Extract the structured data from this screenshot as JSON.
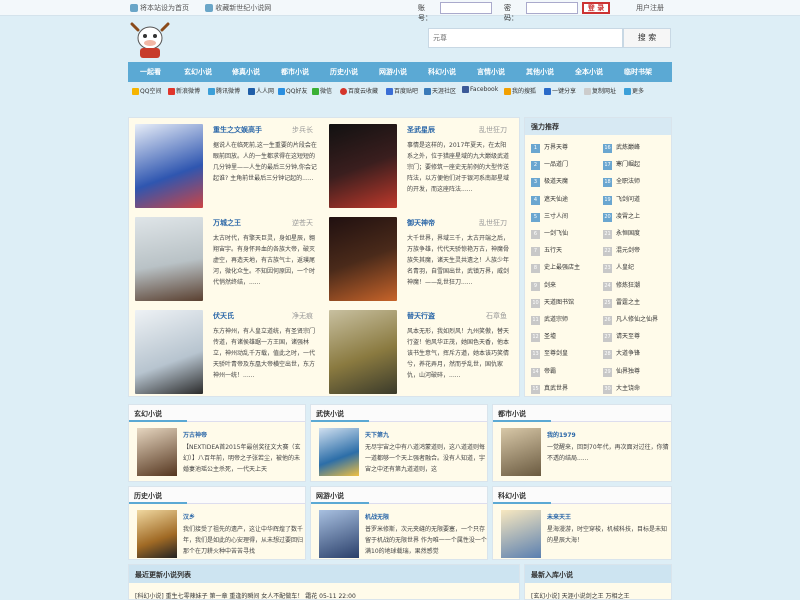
{
  "topbar": {
    "set_home": "将本站设为首页",
    "bookmark": "收藏新世纪小说网",
    "account_label": "账号：",
    "password_label": "密码：",
    "login": "登 录",
    "register": "用户注册"
  },
  "search": {
    "placeholder": "元尊",
    "button": "搜 索"
  },
  "nav": [
    "一起看",
    "玄幻小说",
    "修真小说",
    "都市小说",
    "历史小说",
    "网游小说",
    "科幻小说",
    "言情小说",
    "其他小说",
    "全本小说",
    "临时书架"
  ],
  "share": [
    "QQ空间",
    "新浪微博",
    "腾讯微博",
    "人人网",
    "QQ好友",
    "微信",
    "百度云收藏",
    "百度贴吧",
    "天涯社区",
    "Facebook",
    "我的搜狐",
    "一键分享",
    "复制网址",
    "更多"
  ],
  "featured": [
    {
      "title": "重生之文娱高手",
      "author": "步兵长",
      "desc": "据说人在临死前,这一生重要的片段会在眼前回放。人的一生都求得在这短短的几分钟里——人生的最后三分钟,你会记起谁? 主角前世最后三分钟记起的......",
      "cover_color": "#2f56b0"
    },
    {
      "title": "圣武星辰",
      "author": "乱世狂刀",
      "desc": "事情是这样的，2017年夏天，在太阳系之外，位于猎座星域的九大巅级武道宗门；要修筑一座史无前例的大型传送阵法，以方便他们对于银河系南部星域的开发，而这座阵法......",
      "cover_color": "#3a1e1e"
    },
    {
      "title": "万城之王",
      "author": "逆苍天",
      "desc": "太古时代，有擎天巨灵，身如星辰，翱翔宙宇。有身怀异血的各族大帝，破灭虚空，再造天地，有古族气士，返璞尾河，微化众生。不知因何原因，一个时代悄然终结，......",
      "cover_color": "#b9c2c6"
    },
    {
      "title": "御天神帝",
      "author": "乱世狂刀",
      "desc": "大千世界，界域三千，太古开端之后，万族争雄，代代天骄惊艳万古，神魔骨族失其魔，诸天生灵共遗之！人族少年名青羽，自雪国出世，武镇万界，威剑神魔！——乱世狂刀......",
      "cover_color": "#4a2a1a"
    },
    {
      "title": "伏天氏",
      "author": "净无痕",
      "desc": "东方神州，有人皇立道统，有圣贤宗门传道，有诸侯雄踞一方王国，诸强林立，神州动乱千万载，值此之时，一代天骄叶青帝及东凰大帝横空出世，东方神州一统！......",
      "cover_color": "#b7c4cf"
    },
    {
      "title": "替天行盗",
      "author": "石章鱼",
      "desc": "风本无形，我如烈风！九州笑傲，替天行盗！他风华正茂，她国色天香，他本该书生意气，挥斥方遒，她本该巧笑倩兮，养花弄月，然而乎乱世，国仇家仇，山河破碎，......",
      "cover_color": "#8a7a40"
    }
  ],
  "recommend": {
    "title": "强力推荐",
    "left": [
      {
        "n": "1",
        "name": "万界天尊"
      },
      {
        "n": "2",
        "name": "一品道门"
      },
      {
        "n": "3",
        "name": "极道天魔"
      },
      {
        "n": "4",
        "name": "遮天仙途"
      },
      {
        "n": "5",
        "name": "三寸人间"
      },
      {
        "n": "6",
        "name": "一剑飞仙"
      },
      {
        "n": "7",
        "name": "五行天"
      },
      {
        "n": "8",
        "name": "史上最强店主"
      },
      {
        "n": "9",
        "name": "剑来"
      },
      {
        "n": "10",
        "name": "天道图书馆"
      },
      {
        "n": "11",
        "name": "武道宗师"
      },
      {
        "n": "12",
        "name": "圣墟"
      },
      {
        "n": "13",
        "name": "至尊剑皇"
      },
      {
        "n": "14",
        "name": "帝霸"
      },
      {
        "n": "15",
        "name": "真武世界"
      }
    ],
    "right": [
      {
        "n": "16",
        "name": "武炼巅峰"
      },
      {
        "n": "17",
        "name": "寒门崛起"
      },
      {
        "n": "18",
        "name": "全职法师"
      },
      {
        "n": "19",
        "name": "飞剑问道"
      },
      {
        "n": "20",
        "name": "凌霄之上"
      },
      {
        "n": "21",
        "name": "永恒国度"
      },
      {
        "n": "22",
        "name": "混元剑帝"
      },
      {
        "n": "23",
        "name": "人皇纪"
      },
      {
        "n": "24",
        "name": "修炼狂潮"
      },
      {
        "n": "25",
        "name": "雷霆之主"
      },
      {
        "n": "26",
        "name": "凡人修仙之仙界"
      },
      {
        "n": "27",
        "name": "请天至尊"
      },
      {
        "n": "28",
        "name": "大道争锋"
      },
      {
        "n": "29",
        "name": "仙界独尊"
      },
      {
        "n": "30",
        "name": "大主饶命"
      }
    ]
  },
  "sections": [
    {
      "name": "玄幻小说",
      "title": "万古神帝",
      "desc": "【NEXTIDEA首2015年最创奖征文大赛（玄幻）】八百年前，明帝之子张若尘，被他的未婚妻池瑶公主杀死，一代天上天",
      "cover_color": "#55361f"
    },
    {
      "name": "武侠小说",
      "title": "天下第九",
      "desc": "无尽宇宙之中有八道鸿蒙道则，这八道道则每一道都够一个天上强者融合。没有人知道，宇宙之中还有第九道道则，这",
      "cover_color": "#2c6ea8"
    },
    {
      "name": "都市小说",
      "title": "我的1979",
      "desc": "一觉醒来，回到70年代，再次面对过往，你猜不透的结局......",
      "cover_color": "#6a5a40"
    },
    {
      "name": "历史小说",
      "title": "汉乡",
      "desc": "我们接受了祖先的遗产，这让中华辉煌了数千年，我们是如此的心安理得，从未想过要回归那个在刀耕火种中苦苦寻找",
      "cover_color": "#a06a25"
    },
    {
      "name": "网游小说",
      "title": "机战无限",
      "desc": "普罗米修斯，次元夹缝的无限要塞，一个只存留于机战的无限世界 作为唯一一个属性没一个满10的地球载瑞，果然感觉",
      "cover_color": "#2a3f6a"
    },
    {
      "name": "科幻小说",
      "title": "未来天王",
      "desc": "星海漫游，时空穿梭，机械科技，目标是未知的星辰大海！",
      "cover_color": "#5a7fb0"
    }
  ],
  "updates": {
    "title": "最近更新小说列表",
    "first_row": "[科幻小说]    重生七零辣妹子    第一章 重逢的瞬间    女人不配做车！    霜花    05-11 22:00"
  },
  "new_in": {
    "title": "最新入库小说",
    "first_row": "[玄幻小说]  天涯小说剑之王        万相之王"
  }
}
